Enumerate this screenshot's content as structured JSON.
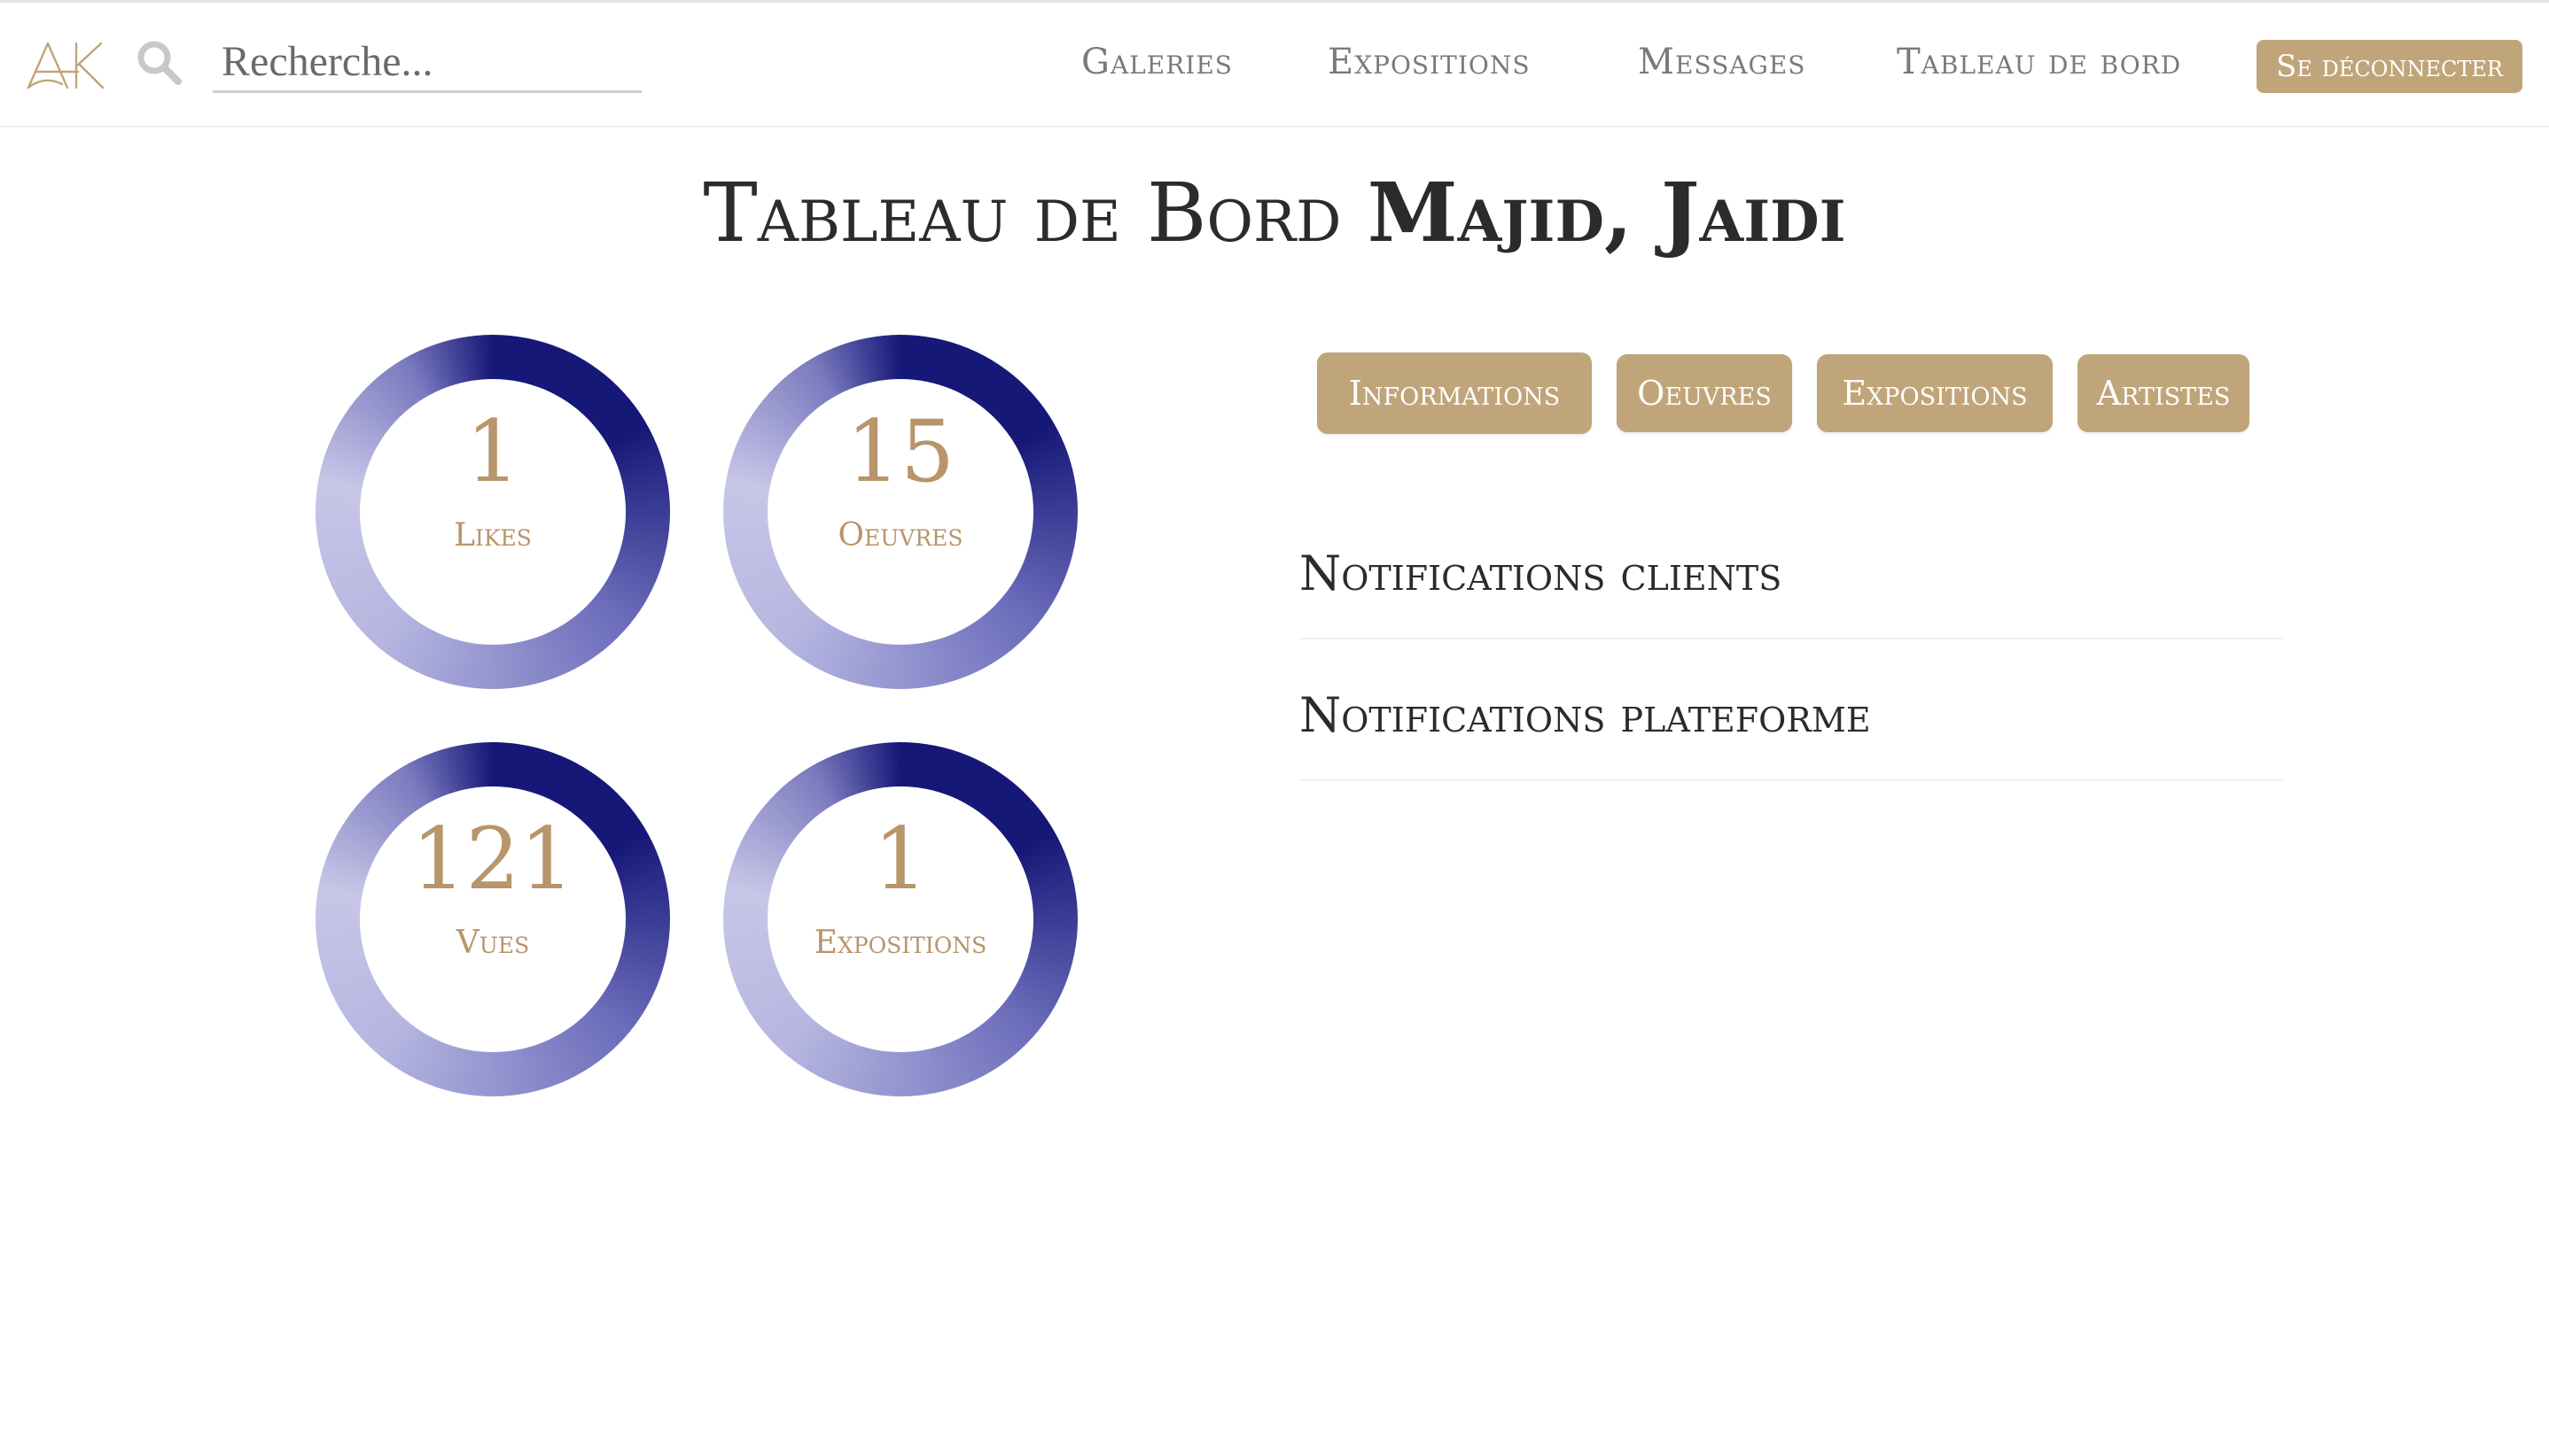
{
  "header": {
    "logo_text": "AK",
    "search_placeholder": "Recherche...",
    "nav": [
      "Galeries",
      "Expositions",
      "Messages",
      "Tableau de bord"
    ],
    "logout_label": "Se déconnecter",
    "colors": {
      "accent": "#c0a57a",
      "nav_text": "#7a7a7a"
    }
  },
  "page": {
    "title_prefix": "Tableau de Bord",
    "title_name": "Majid, Jaidi"
  },
  "stats": [
    {
      "value": "1",
      "label": "Likes"
    },
    {
      "value": "15",
      "label": "Oeuvres"
    },
    {
      "value": "121",
      "label": "Vues"
    },
    {
      "value": "1",
      "label": "Expositions"
    }
  ],
  "tabs": [
    "Informations",
    "Oeuvres",
    "Expositions",
    "Artistes"
  ],
  "notifications": {
    "clients_title": "Notifications clients",
    "platform_title": "Notifications plateforme"
  },
  "colors": {
    "ring_dark": "#161878",
    "ring_light": "#c7c6e7",
    "stat_text": "#b8956a"
  }
}
